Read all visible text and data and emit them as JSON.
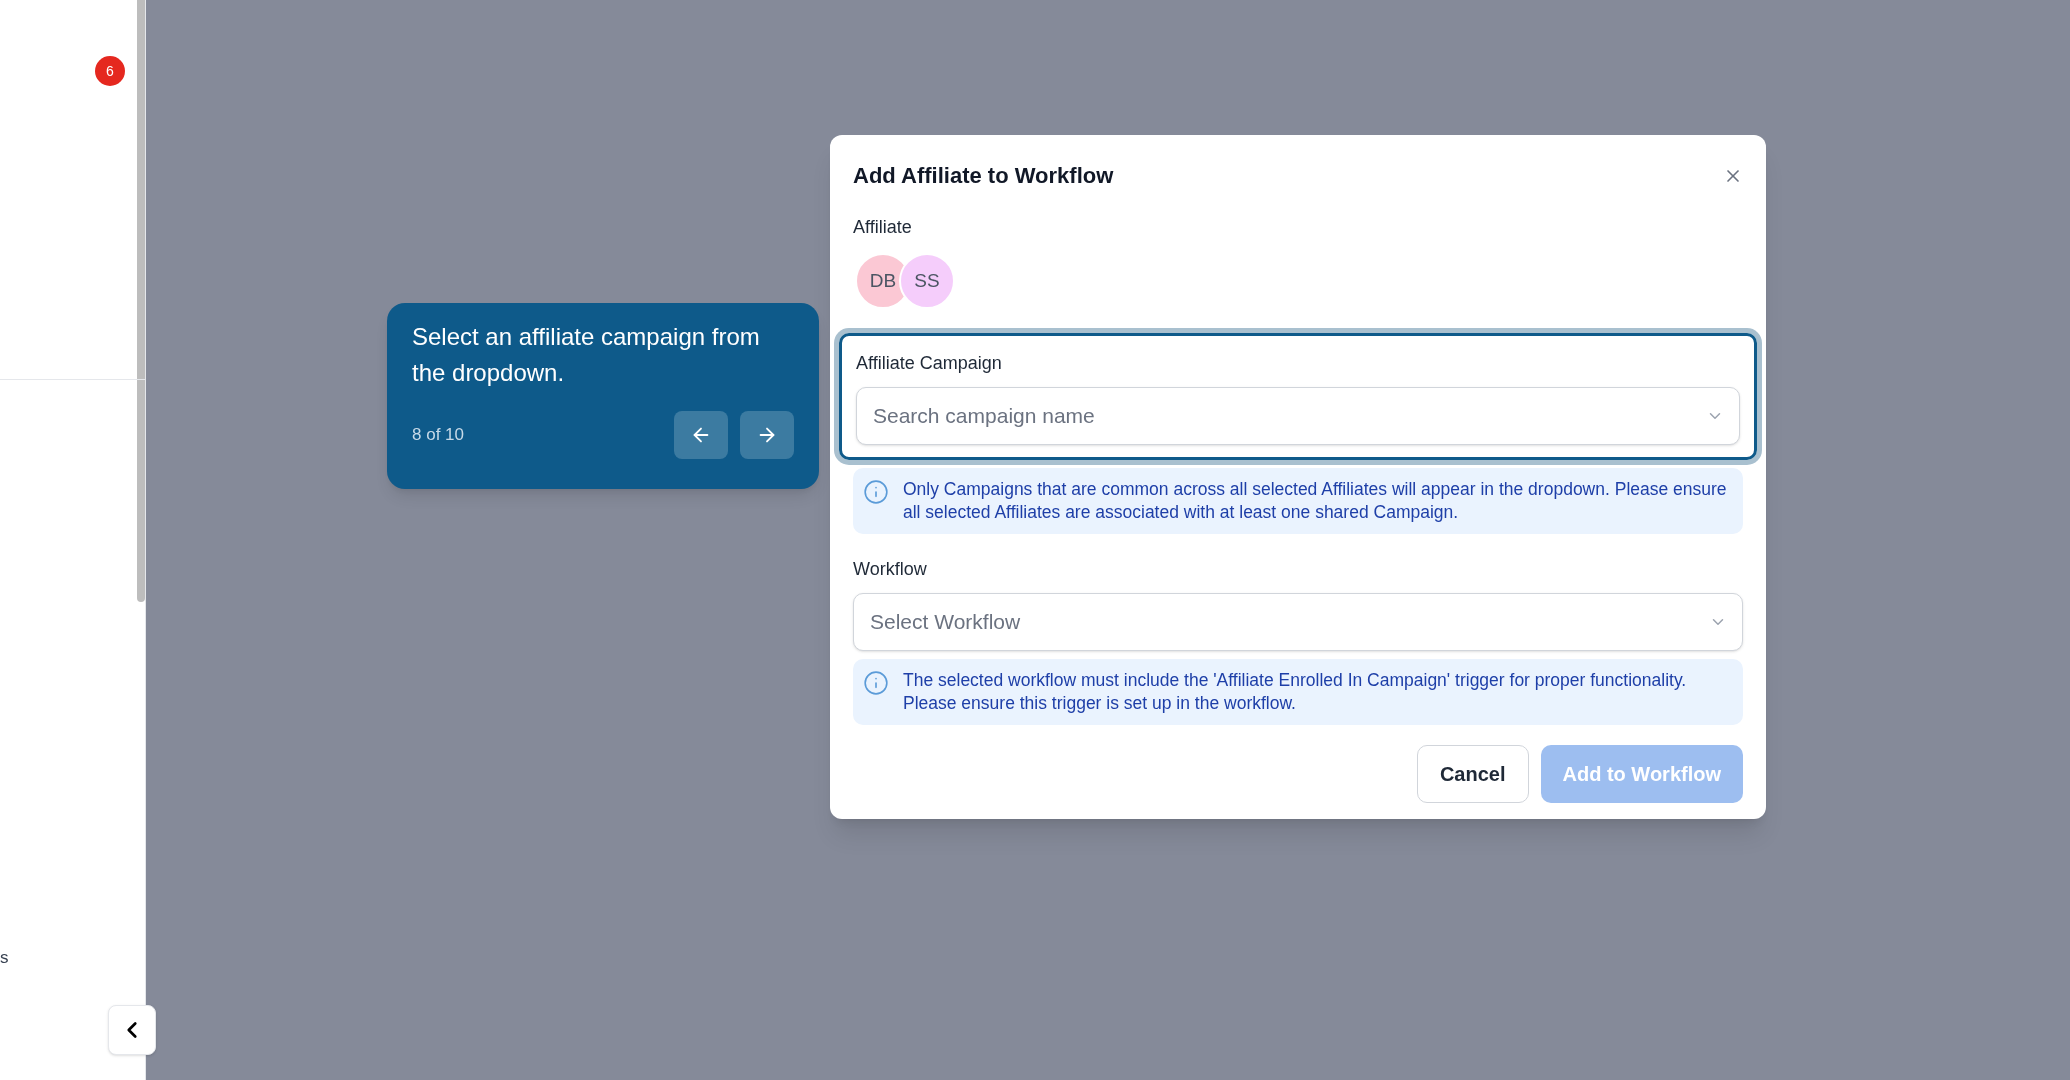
{
  "sidebar": {
    "badge": "6",
    "cut_text": "s"
  },
  "tour_tooltip": {
    "text": "Select an affiliate campaign from the dropdown.",
    "step": "8 of 10"
  },
  "dialog": {
    "title": "Add Affiliate to Workflow",
    "affiliate_label": "Affiliate",
    "avatars": [
      {
        "initials": "DB",
        "color": "#fbc8d4"
      },
      {
        "initials": "SS",
        "color": "#f5cdfb"
      }
    ],
    "campaign_field": {
      "label": "Affiliate Campaign",
      "placeholder": "Search campaign name",
      "highlighted": true
    },
    "campaign_info": "Only Campaigns that are common across all selected Affiliates will appear in the dropdown. Please ensure all selected Affiliates are associated with at least one shared Campaign.",
    "workflow_field": {
      "label": "Workflow",
      "placeholder": "Select Workflow",
      "highlighted": false
    },
    "workflow_info": "The selected workflow must include the 'Affiliate Enrolled In Campaign' trigger for proper functionality. Please ensure this trigger is set up in the workflow.",
    "buttons": [
      {
        "label": "Cancel",
        "kind": "secondary",
        "disabled": false
      },
      {
        "label": "Add to Workflow",
        "kind": "primary",
        "disabled": true
      }
    ]
  }
}
